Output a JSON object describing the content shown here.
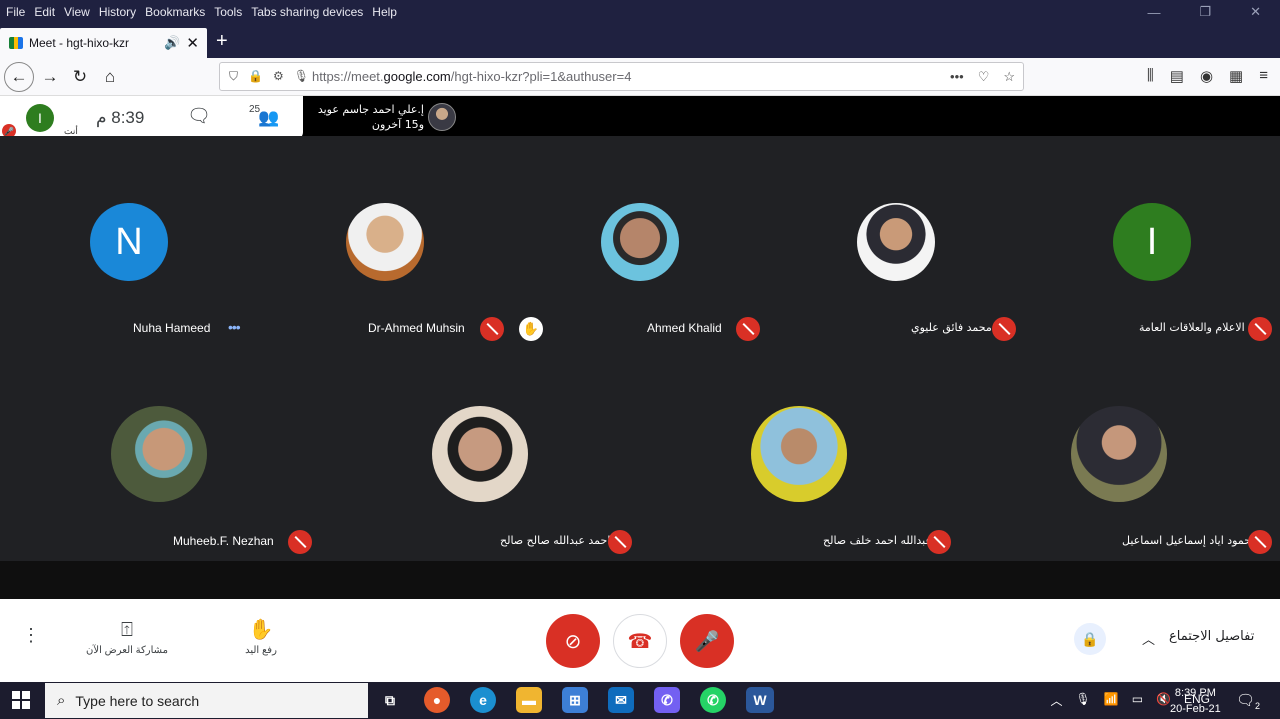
{
  "browser": {
    "menu": [
      "File",
      "Edit",
      "View",
      "History",
      "Bookmarks",
      "Tools",
      "Tabs sharing devices",
      "Help"
    ],
    "tab_title": "Meet - hgt-hixo-kzr",
    "url_prefix": "https://meet.",
    "url_domain": "google.com",
    "url_path": "/hgt-hixo-kzr?pli=1&authuser=4"
  },
  "meet": {
    "self_initial": "I",
    "self_label": "أنت",
    "time": "8:39 م",
    "participant_count": "25",
    "presenter_line1": "إ.علي احمد جاسم عويد",
    "presenter_line2": "و15 آخرون",
    "participants": [
      {
        "name": "Nuha Hameed",
        "initial": "N",
        "color": "#1a88d8",
        "status": "speaking"
      },
      {
        "name": "Dr-Ahmed Muhsin",
        "initial": "",
        "color": "#c07a45",
        "status": "muted-hand"
      },
      {
        "name": "Ahmed Khalid",
        "initial": "",
        "color": "#7ecbe0",
        "status": "muted"
      },
      {
        "name": "محمد فائق عليوي",
        "initial": "",
        "color": "#eeeeee",
        "status": "muted"
      },
      {
        "name": "الاعلام والعلاقات العامة",
        "initial": "I",
        "color": "#2e7d1f",
        "status": "muted"
      },
      {
        "name": "Muheeb.F. Nezhan",
        "initial": "",
        "color": "#5b6b4a",
        "status": "muted"
      },
      {
        "name": "احمد عبدالله صالح صالح",
        "initial": "",
        "color": "#d9c7b0",
        "status": "muted"
      },
      {
        "name": "عبدالله احمد خلف صالح",
        "initial": "",
        "color": "#c9c43a",
        "status": "muted"
      },
      {
        "name": "محمود اياد إسماعيل اسماعيل",
        "initial": "",
        "color": "#6b6a55",
        "status": "muted"
      }
    ],
    "controls": {
      "present_label": "مشاركة العرض الآن",
      "raise_hand_label": "رفع اليد",
      "details_label": "تفاصيل الاجتماع"
    }
  },
  "taskbar": {
    "search_placeholder": "Type here to search",
    "lang": "ENG",
    "time": "8:39 PM",
    "date": "20-Feb-21",
    "notif_count": "2"
  }
}
